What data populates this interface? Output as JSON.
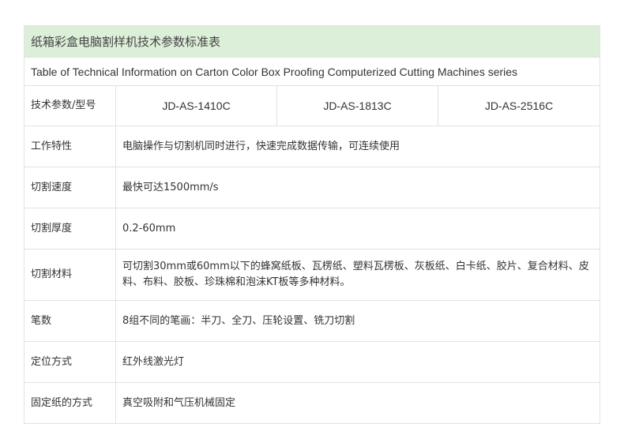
{
  "table": {
    "title": "纸箱彩盒电脑割样机技术参数标准表",
    "subtitle": "Table of Technical Information on Carton Color Box Proofing Computerized Cutting Machines series",
    "header_label": "技术参数/型号",
    "models": [
      "JD-AS-1410C",
      "JD-AS-1813C",
      "JD-AS-2516C"
    ],
    "rows": [
      {
        "label": "工作特性",
        "value": "电脑操作与切割机同时进行，快速完成数据传输，可连续使用"
      },
      {
        "label": "切割速度",
        "value": "最快可达1500mm/s"
      },
      {
        "label": "切割厚度",
        "value": "0.2-60mm"
      },
      {
        "label": "切割材料",
        "value": "可切割30mm或60mm以下的蜂窝纸板、瓦楞纸、塑料瓦楞板、灰板纸、白卡纸、胶片、复合材料、皮料、布料、胶板、珍珠棉和泡沫KT板等多种材料。"
      },
      {
        "label": "笔数",
        "value": "8组不同的笔画：半刀、全刀、压轮设置、铣刀切割"
      },
      {
        "label": "定位方式",
        "value": "红外线激光灯"
      },
      {
        "label": "固定纸的方式",
        "value": "真空吸附和气压机械固定"
      }
    ]
  }
}
